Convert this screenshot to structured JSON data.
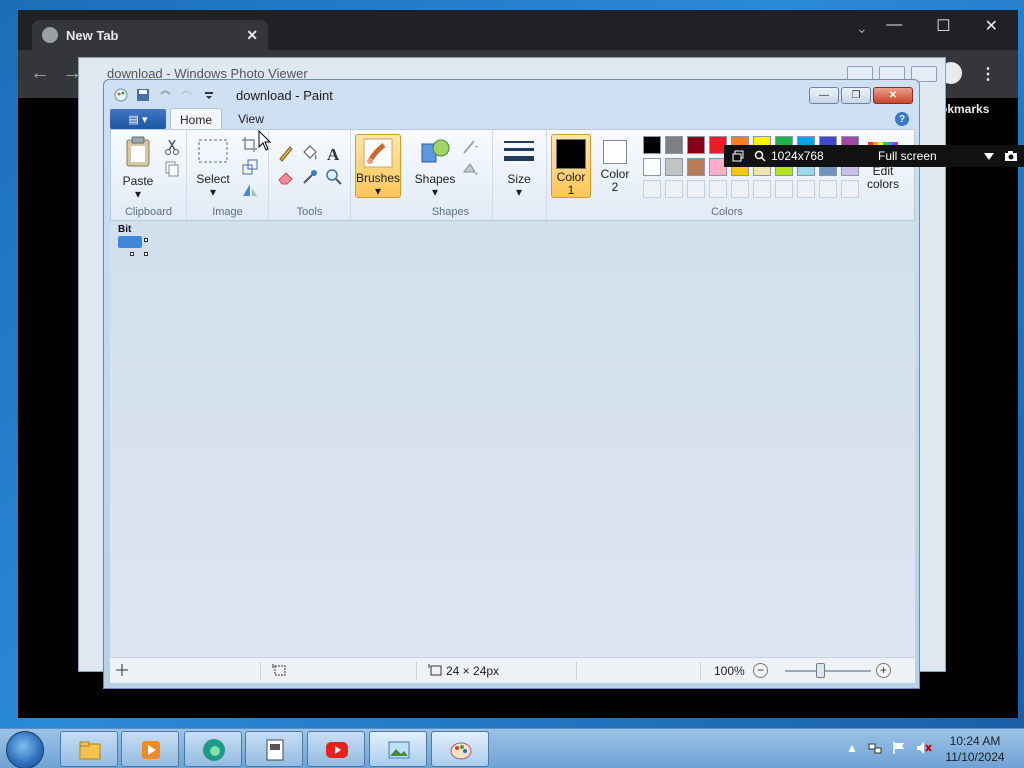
{
  "chrome": {
    "tab_title": "New Tab",
    "tab_close": "✕",
    "new_tab_chevron": "⌄",
    "win_minimize": "—",
    "win_maximize": "☐",
    "win_close": "✕",
    "back": "←",
    "forward": "→",
    "menu": "⋮",
    "bookmarks_fragment": "okmarks"
  },
  "photo_viewer": {
    "title": "download - Windows Photo Viewer"
  },
  "paint": {
    "title": "download - Paint",
    "tabs": {
      "file": "▤ ▾",
      "home": "Home",
      "view": "View"
    },
    "help": "?",
    "win_min": "—",
    "win_max": "❐",
    "win_close": "✕",
    "groups": {
      "clipboard": "Clipboard",
      "image": "Image",
      "tools": "Tools",
      "shapes": "Shapes",
      "colors": "Colors"
    },
    "buttons": {
      "paste": "Paste",
      "select": "Select",
      "brushes": "Brushes",
      "shapes": "Shapes",
      "size": "Size",
      "color1_line1": "Color",
      "color1_line2": "1",
      "color2_line1": "Color",
      "color2_line2": "2",
      "edit_colors_line1": "Edit",
      "edit_colors_line2": "colors",
      "dropdown": "▾"
    },
    "palette_row1": [
      "#000000",
      "#7f7f7f",
      "#880015",
      "#ed1c24",
      "#ff7f27",
      "#fff200",
      "#22b14c",
      "#00a2e8",
      "#3f48cc",
      "#a349a4"
    ],
    "palette_row2": [
      "#ffffff",
      "#c3c3c3",
      "#b97a57",
      "#ffaec9",
      "#ffc90e",
      "#efe4b0",
      "#b5e61d",
      "#99d9ea",
      "#7092be",
      "#c8bfe7"
    ],
    "color1": "#000000",
    "color2": "#ffffff",
    "image_text": "Bit",
    "status": {
      "image_size": "24 × 24px",
      "zoom": "100%",
      "zoom_minus": "−",
      "zoom_plus": "+"
    }
  },
  "overlay": {
    "resolution": "1024x768",
    "mode": "Full screen"
  },
  "taskbar": {
    "time": "10:24 AM",
    "date": "11/10/2024",
    "tray_up": "▲"
  }
}
